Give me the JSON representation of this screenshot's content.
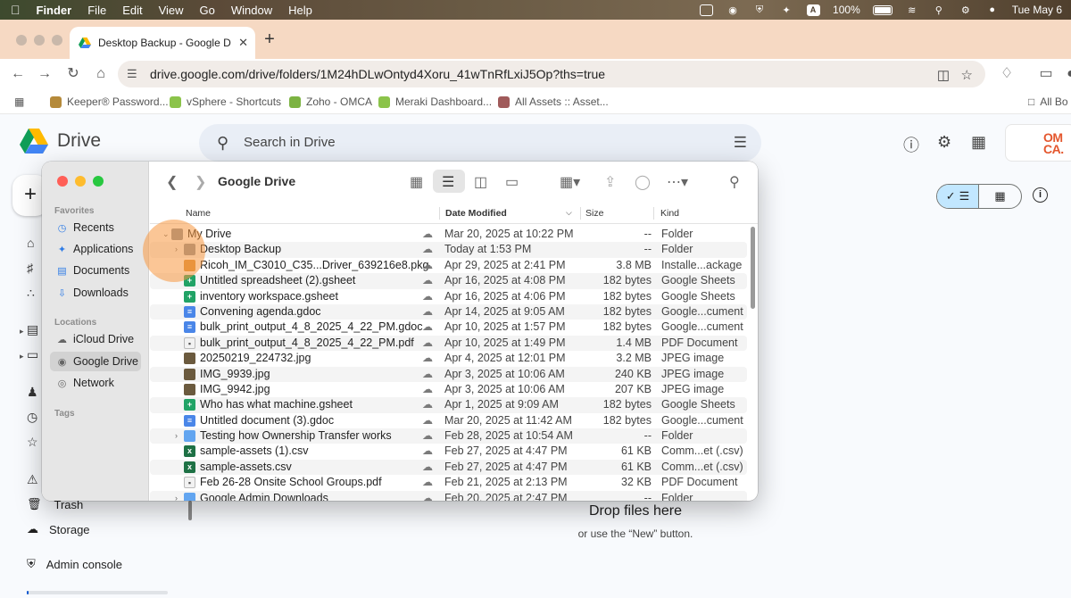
{
  "menubar": {
    "app": "Finder",
    "items": [
      "File",
      "Edit",
      "View",
      "Go",
      "Window",
      "Help"
    ],
    "status_letter": "A",
    "battery": "100%",
    "clock": "Tue May 6"
  },
  "browser": {
    "tab_title": "Desktop Backup - Google Dri",
    "url": "drive.google.com/drive/folders/1M24hDLwOntyd4Xoru_41wTnRfLxiJ5Op?ths=true",
    "bookmarks": [
      "Keeper® Password...",
      "vSphere - Shortcuts",
      "Zoho - OMCA",
      "Meraki Dashboard...",
      "All Assets :: Asset..."
    ],
    "bookmarks_right": "All Bo"
  },
  "drive": {
    "logo_text": "Drive",
    "search_placeholder": "Search in Drive",
    "account_logo_line1": "OM",
    "account_logo_line2": "CA.",
    "trash": "Trash",
    "storage": "Storage",
    "admin_console": "Admin console",
    "drop_title": "Drop files here",
    "drop_subtitle": "or use the “New” button."
  },
  "finder": {
    "title": "Google Drive",
    "favorites_label": "Favorites",
    "favorites": [
      "Recents",
      "Applications",
      "Documents",
      "Downloads"
    ],
    "locations_label": "Locations",
    "locations": [
      "iCloud Drive",
      "Google Drive",
      "Network"
    ],
    "tags_label": "Tags",
    "columns": {
      "name": "Name",
      "date": "Date Modified",
      "size": "Size",
      "kind": "Kind"
    },
    "rows": [
      {
        "name": "My Drive",
        "date": "Mar 20, 2025 at 10:22 PM",
        "size": "--",
        "kind": "Folder",
        "icon": "gray-folder",
        "indent": 0,
        "caret": "v"
      },
      {
        "name": "Desktop Backup",
        "date": "Today at 1:53 PM",
        "size": "--",
        "kind": "Folder",
        "icon": "gray-folder",
        "indent": 1,
        "caret": ">"
      },
      {
        "name": "Ricoh_IM_C3010_C35...Driver_639216e8.pkg",
        "date": "Apr 29, 2025 at 2:41 PM",
        "size": "3.8 MB",
        "kind": "Installe...ackage",
        "icon": "pkg",
        "indent": 1,
        "caret": ""
      },
      {
        "name": "Untitled spreadsheet (2).gsheet",
        "date": "Apr 16, 2025 at 4:08 PM",
        "size": "182 bytes",
        "kind": "Google Sheets",
        "icon": "sheet",
        "indent": 1,
        "caret": ""
      },
      {
        "name": "inventory workspace.gsheet",
        "date": "Apr 16, 2025 at 4:06 PM",
        "size": "182 bytes",
        "kind": "Google Sheets",
        "icon": "sheet",
        "indent": 1,
        "caret": ""
      },
      {
        "name": "Convening agenda.gdoc",
        "date": "Apr 14, 2025 at 9:05 AM",
        "size": "182 bytes",
        "kind": "Google...cument",
        "icon": "doc",
        "indent": 1,
        "caret": ""
      },
      {
        "name": "bulk_print_output_4_8_2025_4_22_PM.gdoc",
        "date": "Apr 10, 2025 at 1:57 PM",
        "size": "182 bytes",
        "kind": "Google...cument",
        "icon": "doc",
        "indent": 1,
        "caret": ""
      },
      {
        "name": "bulk_print_output_4_8_2025_4_22_PM.pdf",
        "date": "Apr 10, 2025 at 1:49 PM",
        "size": "1.4 MB",
        "kind": "PDF Document",
        "icon": "pdf",
        "indent": 1,
        "caret": ""
      },
      {
        "name": "20250219_224732.jpg",
        "date": "Apr 4, 2025 at 12:01 PM",
        "size": "3.2 MB",
        "kind": "JPEG image",
        "icon": "img",
        "indent": 1,
        "caret": ""
      },
      {
        "name": "IMG_9939.jpg",
        "date": "Apr 3, 2025 at 10:06 AM",
        "size": "240 KB",
        "kind": "JPEG image",
        "icon": "img",
        "indent": 1,
        "caret": ""
      },
      {
        "name": "IMG_9942.jpg",
        "date": "Apr 3, 2025 at 10:06 AM",
        "size": "207 KB",
        "kind": "JPEG image",
        "icon": "img",
        "indent": 1,
        "caret": ""
      },
      {
        "name": "Who has what machine.gsheet",
        "date": "Apr 1, 2025 at 9:09 AM",
        "size": "182 bytes",
        "kind": "Google Sheets",
        "icon": "sheet",
        "indent": 1,
        "caret": ""
      },
      {
        "name": "Untitled document (3).gdoc",
        "date": "Mar 20, 2025 at 11:42 AM",
        "size": "182 bytes",
        "kind": "Google...cument",
        "icon": "doc",
        "indent": 1,
        "caret": ""
      },
      {
        "name": "Testing how Ownership Transfer works",
        "date": "Feb 28, 2025 at 10:54 AM",
        "size": "--",
        "kind": "Folder",
        "icon": "folder",
        "indent": 1,
        "caret": ">"
      },
      {
        "name": "sample-assets (1).csv",
        "date": "Feb 27, 2025 at 4:47 PM",
        "size": "61 KB",
        "kind": "Comm...et (.csv)",
        "icon": "csv",
        "indent": 1,
        "caret": ""
      },
      {
        "name": "sample-assets.csv",
        "date": "Feb 27, 2025 at 4:47 PM",
        "size": "61 KB",
        "kind": "Comm...et (.csv)",
        "icon": "csv",
        "indent": 1,
        "caret": ""
      },
      {
        "name": "Feb 26-28 Onsite School Groups.pdf",
        "date": "Feb 21, 2025 at 2:13 PM",
        "size": "32 KB",
        "kind": "PDF Document",
        "icon": "pdf",
        "indent": 1,
        "caret": ""
      },
      {
        "name": "Google Admin Downloads",
        "date": "Feb 20, 2025 at 2:47 PM",
        "size": "--",
        "kind": "Folder",
        "icon": "folder",
        "indent": 1,
        "caret": ">"
      }
    ]
  }
}
